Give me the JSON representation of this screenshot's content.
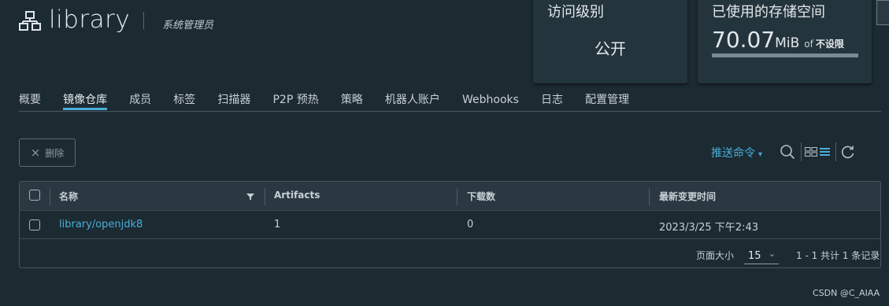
{
  "header": {
    "project_name": "library",
    "role": "系统管理员"
  },
  "cards": {
    "access": {
      "title": "访问级别",
      "value": "公开"
    },
    "storage": {
      "title": "已使用的存储空间",
      "used_value": "70.07",
      "used_unit": "MiB",
      "of": "of",
      "limit": "不设限"
    }
  },
  "tabs": [
    {
      "label": "概要"
    },
    {
      "label": "镜像仓库",
      "active": true
    },
    {
      "label": "成员"
    },
    {
      "label": "标签"
    },
    {
      "label": "扫描器"
    },
    {
      "label": "P2P 预热"
    },
    {
      "label": "策略"
    },
    {
      "label": "机器人账户"
    },
    {
      "label": "Webhooks"
    },
    {
      "label": "日志"
    },
    {
      "label": "配置管理"
    }
  ],
  "toolbar": {
    "delete_icon": "×",
    "delete_label": "删除",
    "push_command_label": "推送命令",
    "icons": [
      "search-icon",
      "card-view-icon",
      "list-view-icon",
      "refresh-icon"
    ]
  },
  "table": {
    "columns": [
      "名称",
      "Artifacts",
      "下载数",
      "最新变更时间"
    ],
    "rows": [
      {
        "name": "library/openjdk8",
        "artifacts": "1",
        "downloads": "0",
        "updated": "2023/3/25 下午2:43"
      }
    ],
    "footer": {
      "page_size_label": "页面大小",
      "page_size": "15",
      "pagination_info": "1 - 1 共计 1 条记录"
    }
  },
  "watermark": "CSDN @C_AIAA",
  "colors": {
    "background": "#1c2a32",
    "accent": "#49afd9"
  }
}
